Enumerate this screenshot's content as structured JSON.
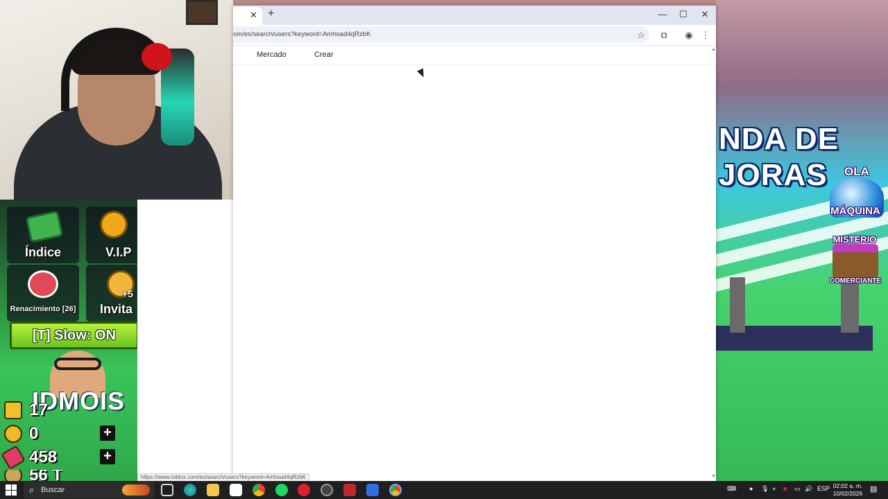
{
  "browser": {
    "url": "om/es/search/users?keyword=Amhoad4qRzbK",
    "status_url": "https://www.roblox.com/es/search/users?keyword=Amhoad4qRzbK",
    "tab_close": "✕",
    "new_tab": "+",
    "minimize": "—",
    "maximize": "☐",
    "close": "✕",
    "nav": {
      "market": "Mercado",
      "create": "Crear"
    }
  },
  "game_hud": {
    "index_label": "Índice",
    "vip_label": "V.I.P",
    "rebirth_label": "Renacimiento [26]",
    "invite_label": "Invita",
    "invite_bonus": "+5",
    "slow_toggle": "[T] Slow: ON",
    "player_name": "IDMOIS",
    "level": "17",
    "coins": "0",
    "gems": "458",
    "plus": "+",
    "partial_stat": "56 T"
  },
  "game_world": {
    "shop_line1": "NDA DE",
    "shop_line2": "JORAS",
    "wave_title": "OLA",
    "wave_subtitle": "MÁQUINA",
    "mystery_title": "MISTERIO",
    "mystery_subtitle": "COMERCIANTE"
  },
  "taskbar": {
    "search_placeholder": "Buscar",
    "language": "ESP",
    "time": "02:02 a. m.",
    "date": "10/02/2026"
  },
  "colors": {
    "accent_green": "#69c51f",
    "taskbar": "#1f1f1f",
    "tabbar": "#dfe6f2"
  }
}
